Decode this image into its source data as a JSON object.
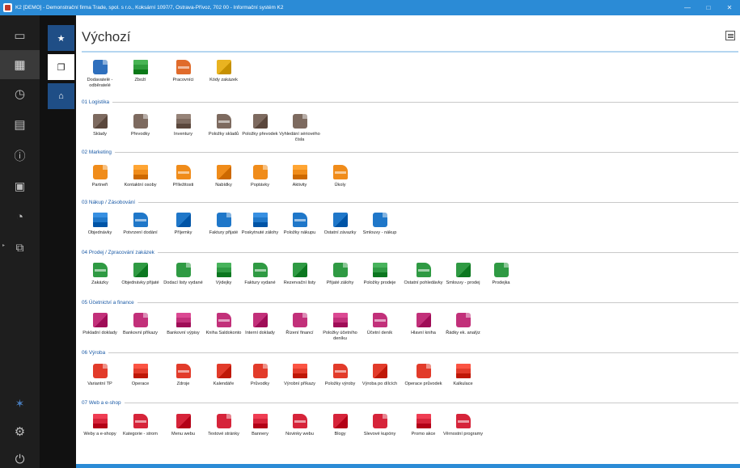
{
  "window": {
    "title": "K2 [DEMO] - Demonstrační firma Trade, spol. s r.o., Koksární 1097/7, Ostrava-Přívoz, 702 00 - Informační systém K2",
    "buttons": [
      "—",
      "□",
      "✕"
    ]
  },
  "page": {
    "title": "Výchozí"
  },
  "favorites": [
    {
      "label": "Dodavatelé - odběratelé",
      "icon": "partners-icon",
      "color": "#2e6fbd"
    },
    {
      "label": "Zboží",
      "icon": "goods-icon",
      "color": "#2e9b3a"
    },
    {
      "label": "Pracovníci",
      "icon": "employees-icon",
      "color": "#e06b2b"
    },
    {
      "label": "Kódy zakázek",
      "icon": "order-codes-icon",
      "color": "#e9b320"
    }
  ],
  "groups": [
    {
      "title": "01 Logistika",
      "color": "#7d6a5f",
      "items": [
        "Sklady",
        "Převodky",
        "Inventury",
        "Položky skladů",
        "Položky převodek",
        "Vyhledání sériového čísla"
      ]
    },
    {
      "title": "02 Marketing",
      "color": "#f08c1a",
      "items": [
        "Partneři",
        "Kontaktní osoby",
        "Příležitosti",
        "Nabídky",
        "Poptávky",
        "Aktivity",
        "Úkoly"
      ]
    },
    {
      "title": "03 Nákup / Zásobování",
      "color": "#1f77c9",
      "items": [
        "Objednávky",
        "Potvrzení dodání",
        "Příjemky",
        "Faktury přijaté",
        "Poskytnuté zálohy",
        "Položky nákupu",
        "Ostatní závazky",
        "Smlouvy - nákup"
      ]
    },
    {
      "title": "04 Prodej / Zpracování zakázek",
      "color": "#2f9a43",
      "items": [
        "Zakázky",
        "Objednávky přijaté",
        "Dodací listy vydané",
        "Výdejky",
        "Faktury vydané",
        "Rezervační listy",
        "Přijaté zálohy",
        "Položky prodeje",
        "Ostatní pohledávky",
        "Smlouvy - prodej",
        "Prodejka"
      ]
    },
    {
      "title": "05 Účetnictví a finance",
      "color": "#c2307a",
      "items": [
        "Pokladní doklady",
        "Bankovní příkazy",
        "Bankovní výpisy",
        "Kniha Saldokonto",
        "Interní doklady",
        "Řízení financí",
        "Položky účetního deníku",
        "Účetní deník",
        "Hlavní kniha",
        "Řádky ek. analýz"
      ]
    },
    {
      "title": "06 Výroba",
      "color": "#e23b2a",
      "items": [
        "Variantní TP",
        "Operace",
        "Zdroje",
        "Kalendáře",
        "Průvodky",
        "Výrobní příkazy",
        "Položky výroby",
        "Výroba po dílcích",
        "Operace průvodek",
        "Kalkulace"
      ]
    },
    {
      "title": "07 Web a e-shop",
      "color": "#d6243a",
      "items": [
        "Weby a e-shopy",
        "Kategorie - strom",
        "Menu webu",
        "Textové stránky",
        "Bannery",
        "Novinky webu",
        "Blogy",
        "Slevové kupóny",
        "Promo akce",
        "Věrnostní programy"
      ]
    }
  ],
  "rail": [
    {
      "icon": "monitor-icon",
      "glyph": "▭"
    },
    {
      "icon": "apps-grid-icon",
      "glyph": "▦"
    },
    {
      "icon": "history-icon",
      "glyph": "◷"
    },
    {
      "icon": "documents-icon",
      "glyph": "▤"
    },
    {
      "icon": "info-icon",
      "glyph": "ⓘ"
    },
    {
      "icon": "calendar-icon",
      "glyph": "▣"
    },
    {
      "icon": "chart-pie-icon",
      "glyph": "◔"
    },
    {
      "icon": "org-structure-icon",
      "glyph": "⧉"
    },
    {
      "icon": "brand-icon",
      "glyph": "✶"
    },
    {
      "icon": "settings-icon",
      "glyph": "⚙"
    },
    {
      "icon": "power-icon",
      "glyph": "⏻"
    }
  ],
  "sub": [
    {
      "icon": "star-icon",
      "glyph": "★"
    },
    {
      "icon": "windows-icon",
      "glyph": "❐"
    },
    {
      "icon": "home-icon",
      "glyph": "⌂"
    }
  ]
}
